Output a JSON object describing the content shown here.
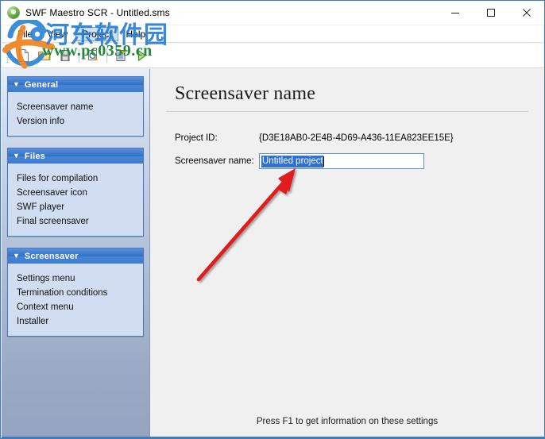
{
  "window": {
    "title": "SWF Maestro SCR - Untitled.sms",
    "icon": "app-globe-icon",
    "minimize_label": "—",
    "maximize_label": "☐",
    "close_label": "✕"
  },
  "menubar": {
    "items": [
      {
        "label": "File",
        "highlighted": false
      },
      {
        "label": "View",
        "highlighted": false
      },
      {
        "label": "Project",
        "highlighted": true
      },
      {
        "label": "Help",
        "highlighted": false
      }
    ]
  },
  "toolbar": {
    "buttons": [
      {
        "name": "new-file-icon",
        "tip": "New"
      },
      {
        "name": "open-folder-icon",
        "tip": "Open"
      },
      {
        "name": "save-disk-icon",
        "tip": "Save"
      },
      {
        "name": "preview-magnifier-icon",
        "tip": "Preview"
      },
      {
        "name": "compile-list-icon",
        "tip": "Compile"
      },
      {
        "name": "run-play-icon",
        "tip": "Run"
      }
    ]
  },
  "sidebar": {
    "groups": [
      {
        "title": "General",
        "caret": "▼",
        "items": [
          {
            "label": "Screensaver name"
          },
          {
            "label": "Version info"
          }
        ]
      },
      {
        "title": "Files",
        "caret": "▼",
        "items": [
          {
            "label": "Files for compilation"
          },
          {
            "label": "Screensaver icon"
          },
          {
            "label": "SWF player"
          },
          {
            "label": "Final screensaver"
          }
        ]
      },
      {
        "title": "Screensaver",
        "caret": "▼",
        "items": [
          {
            "label": "Settings menu"
          },
          {
            "label": "Termination conditions"
          },
          {
            "label": "Context menu"
          },
          {
            "label": "Installer"
          }
        ]
      }
    ]
  },
  "content": {
    "page_title": "Screensaver name",
    "fields": {
      "project_id_label": "Project ID:",
      "project_id_value": "{D3E18AB0-2E4B-4D69-A436-11EA823EE15E}",
      "screensaver_name_label": "Screensaver name:",
      "screensaver_name_value": "Untitled project",
      "screensaver_name_placeholder": "Untitled project"
    },
    "hint": "Press F1 to get information on these settings"
  },
  "watermark": {
    "chinese_text": "河东软件园",
    "url_text": "www.pc0359.cn"
  },
  "colors": {
    "window_border": "#3a7ebf",
    "panel_header_blue": "#2f6fc4",
    "selection_blue": "#2f72d4",
    "input_border": "#5a8fcf",
    "annotation_red": "#e01b1b",
    "watermark_blue": "#2a7fd4",
    "watermark_green": "#1f8a3a"
  }
}
